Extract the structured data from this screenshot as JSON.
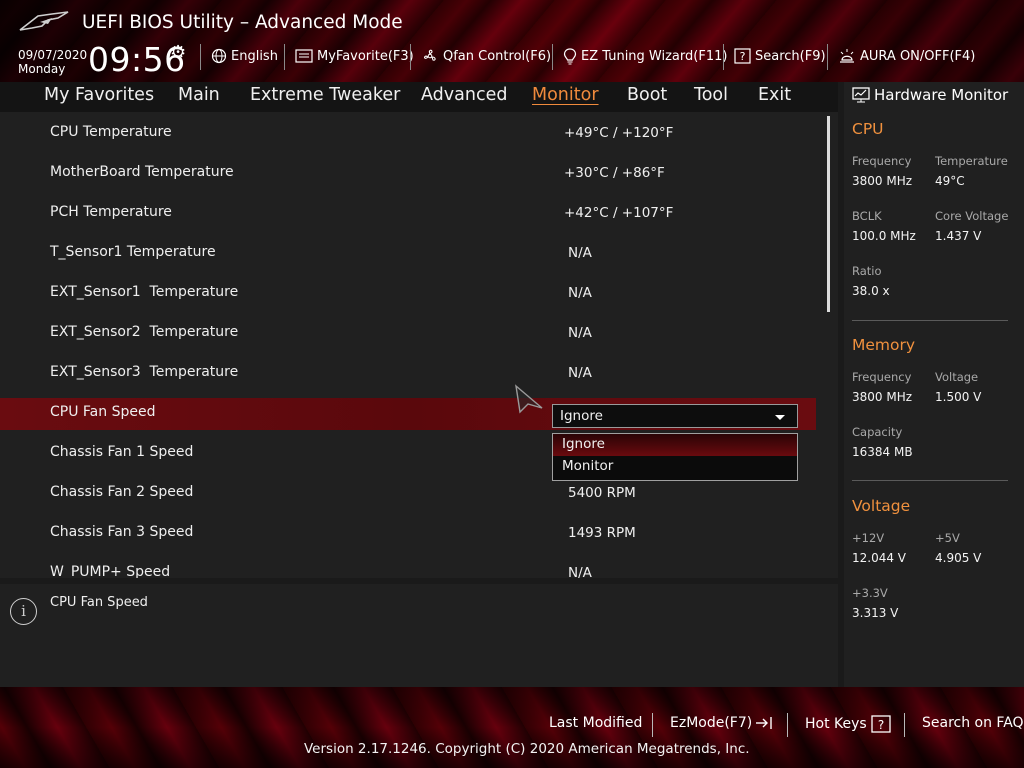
{
  "app": {
    "title": "UEFI BIOS Utility – Advanced Mode",
    "date": "09/07/2020",
    "day": "Monday",
    "time": "09:56"
  },
  "toolbar": {
    "items": [
      {
        "label": "English",
        "icon": "globe-icon"
      },
      {
        "label": "MyFavorite(F3)",
        "icon": "favorite-icon"
      },
      {
        "label": "Qfan Control(F6)",
        "icon": "fan-icon"
      },
      {
        "label": "EZ Tuning Wizard(F11)",
        "icon": "lightbulb-icon"
      },
      {
        "label": "Search(F9)",
        "icon": "help-box-icon"
      },
      {
        "label": "AURA ON/OFF(F4)",
        "icon": "aura-light-icon"
      }
    ]
  },
  "nav": {
    "tabs": [
      "My Favorites",
      "Main",
      "Extreme Tweaker",
      "Advanced",
      "Monitor",
      "Boot",
      "Tool",
      "Exit"
    ],
    "active": "Monitor"
  },
  "settings": {
    "rows": [
      {
        "label": "CPU Temperature",
        "value": "+49°C / +120°F"
      },
      {
        "label": "MotherBoard Temperature",
        "value": "+30°C / +86°F"
      },
      {
        "label": "PCH Temperature",
        "value": "+42°C / +107°F"
      },
      {
        "label": "T_Sensor1 Temperature",
        "value": "N/A"
      },
      {
        "label": "EXT_Sensor1  Temperature",
        "value": "N/A"
      },
      {
        "label": "EXT_Sensor2  Temperature",
        "value": "N/A"
      },
      {
        "label": "EXT_Sensor3  Temperature",
        "value": "N/A"
      },
      {
        "label": "CPU Fan Speed",
        "value": "Ignore"
      },
      {
        "label": "Chassis Fan 1 Speed",
        "value": ""
      },
      {
        "label": "Chassis Fan 2 Speed",
        "value": "5400 RPM"
      },
      {
        "label": "Chassis Fan 3 Speed",
        "value": "1493 RPM"
      },
      {
        "label": "W_PUMP+ Speed",
        "value": "N/A"
      }
    ],
    "dropdown_options": [
      "Ignore",
      "Monitor"
    ],
    "dropdown_highlighted": "Ignore"
  },
  "help": {
    "text": "CPU Fan Speed"
  },
  "hardware_monitor": {
    "title": "Hardware Monitor",
    "cpu": {
      "heading": "CPU",
      "frequency_label": "Frequency",
      "frequency": "3800 MHz",
      "temperature_label": "Temperature",
      "temperature": "49°C",
      "bclk_label": "BCLK",
      "bclk": "100.0 MHz",
      "core_voltage_label": "Core Voltage",
      "core_voltage": "1.437 V",
      "ratio_label": "Ratio",
      "ratio": "38.0 x"
    },
    "memory": {
      "heading": "Memory",
      "frequency_label": "Frequency",
      "frequency": "3800 MHz",
      "voltage_label": "Voltage",
      "voltage": "1.500 V",
      "capacity_label": "Capacity",
      "capacity": "16384 MB"
    },
    "voltage": {
      "heading": "Voltage",
      "v12_label": "+12V",
      "v12": "12.044 V",
      "v5_label": "+5V",
      "v5": "4.905 V",
      "v33_label": "+3.3V",
      "v33": "3.313 V"
    }
  },
  "footer": {
    "last_modified": "Last Modified",
    "ezmode": "EzMode(F7)",
    "hot_keys": "Hot Keys",
    "search_faq": "Search on FAQ",
    "copyright": "Version 2.17.1246. Copyright (C) 2020 American Megatrends, Inc."
  },
  "colors": {
    "accent": "#f0913e",
    "selected_row": "#6a0c10",
    "brand_red": "#7a0010"
  }
}
